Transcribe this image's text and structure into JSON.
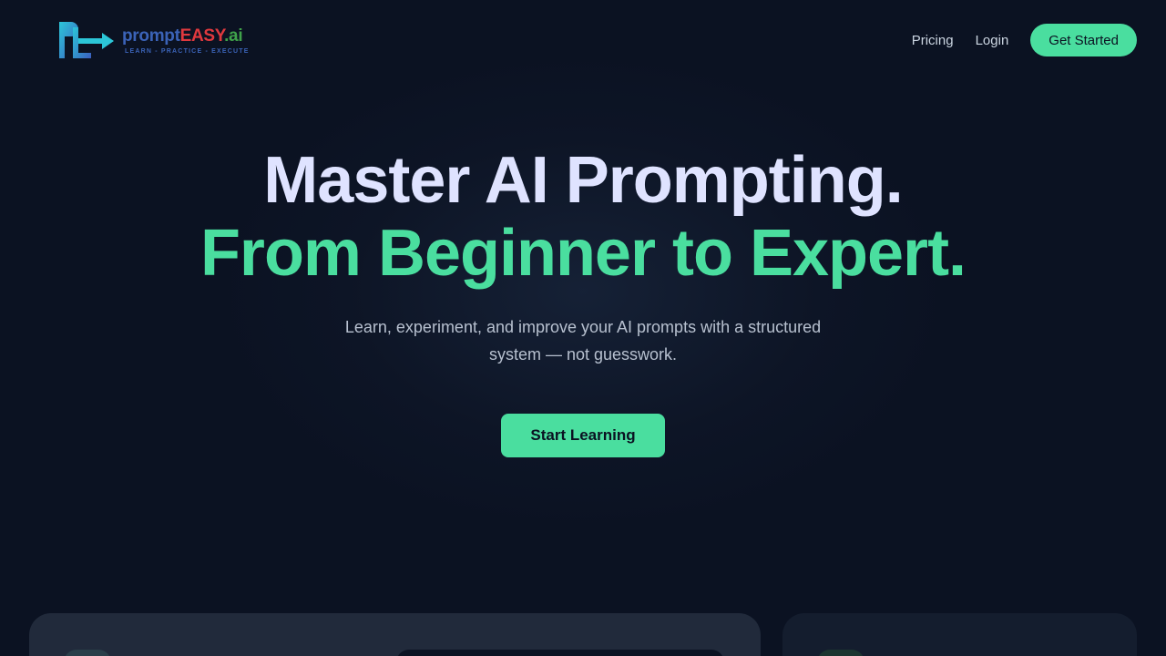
{
  "brand": {
    "word_part1": "prompt",
    "word_part2": "EASY",
    "word_part3": ".ai",
    "tagline": "LEARN - PRACTICE - EXECUTE"
  },
  "nav": {
    "pricing": "Pricing",
    "login": "Login",
    "cta": "Get Started"
  },
  "hero": {
    "title_line1": "Master AI Prompting.",
    "title_line2": "From Beginner to Expert.",
    "subtitle": "Learn, experiment, and improve your AI prompts with a structured system — not guesswork.",
    "cta": "Start Learning"
  },
  "colors": {
    "background": "#0b1222",
    "accent": "#4ade9f",
    "heading": "#dfe3ff"
  }
}
